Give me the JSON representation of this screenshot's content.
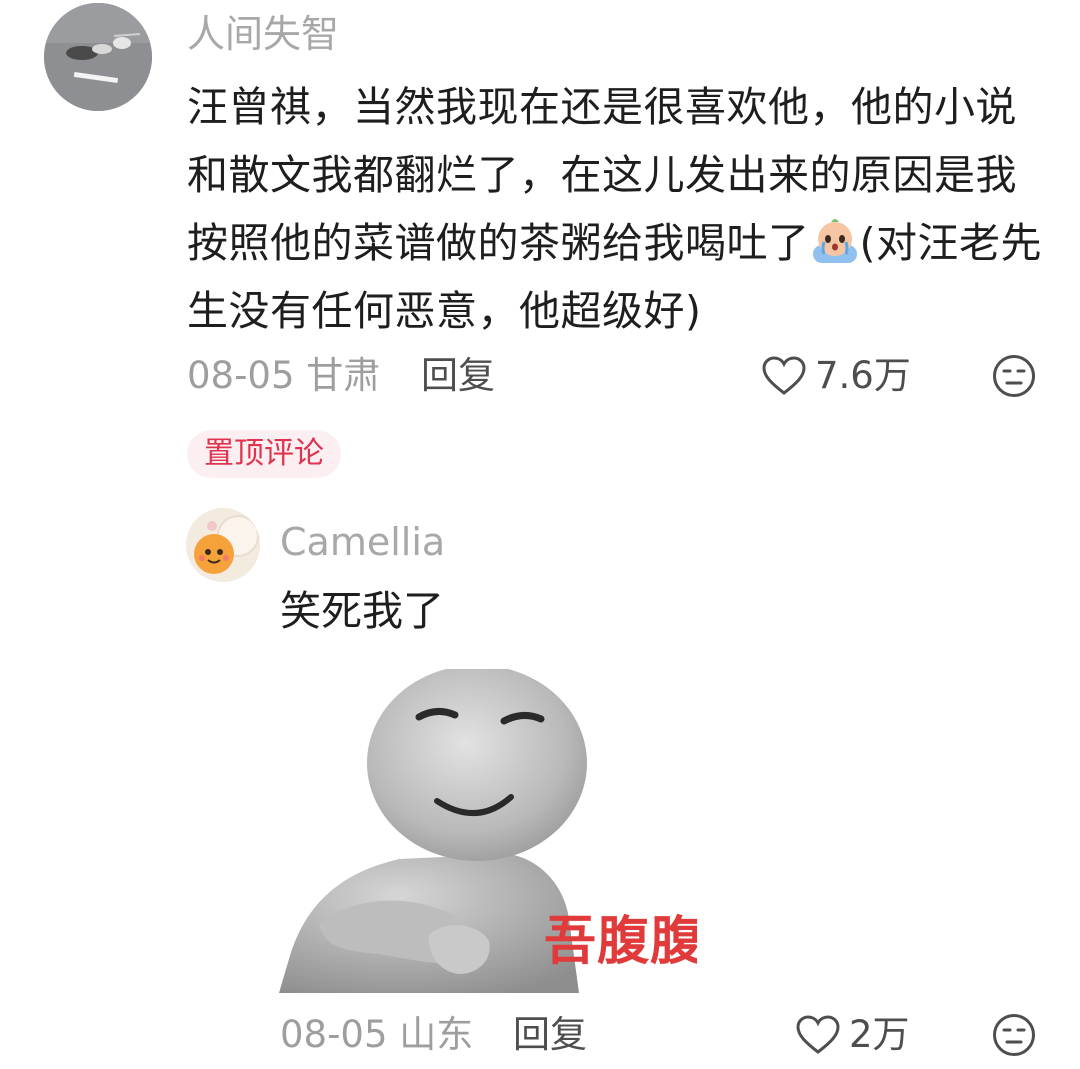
{
  "comment": {
    "username": "人间失智",
    "avatar_icon": "avatar-photo-icon",
    "text_before_emoji": "汪曾祺，当然我现在还是很喜欢他，他的小说和散文我都翻烂了，在这儿发出来的原因是我按照他的菜谱做的茶粥给我喝吐了",
    "emoji": "crying-emoji-icon",
    "text_after_emoji": "(对汪老先生没有任何恶意，他超级好)",
    "date": "08-05",
    "location": "甘肃",
    "reply_label": "回复",
    "like_count": "7.6万",
    "pinned_label": "置顶评论"
  },
  "reply": {
    "username": "Camellia",
    "avatar_icon": "avatar-cartoon-icon",
    "text": "笑死我了",
    "sticker_caption": "吾腹腹",
    "date": "08-05",
    "location": "山东",
    "reply_label": "回复",
    "like_count": "2万"
  },
  "colors": {
    "pinned_text": "#e0334f",
    "pinned_bg": "#fbeff1",
    "sticker_caption": "#e03a3a"
  }
}
